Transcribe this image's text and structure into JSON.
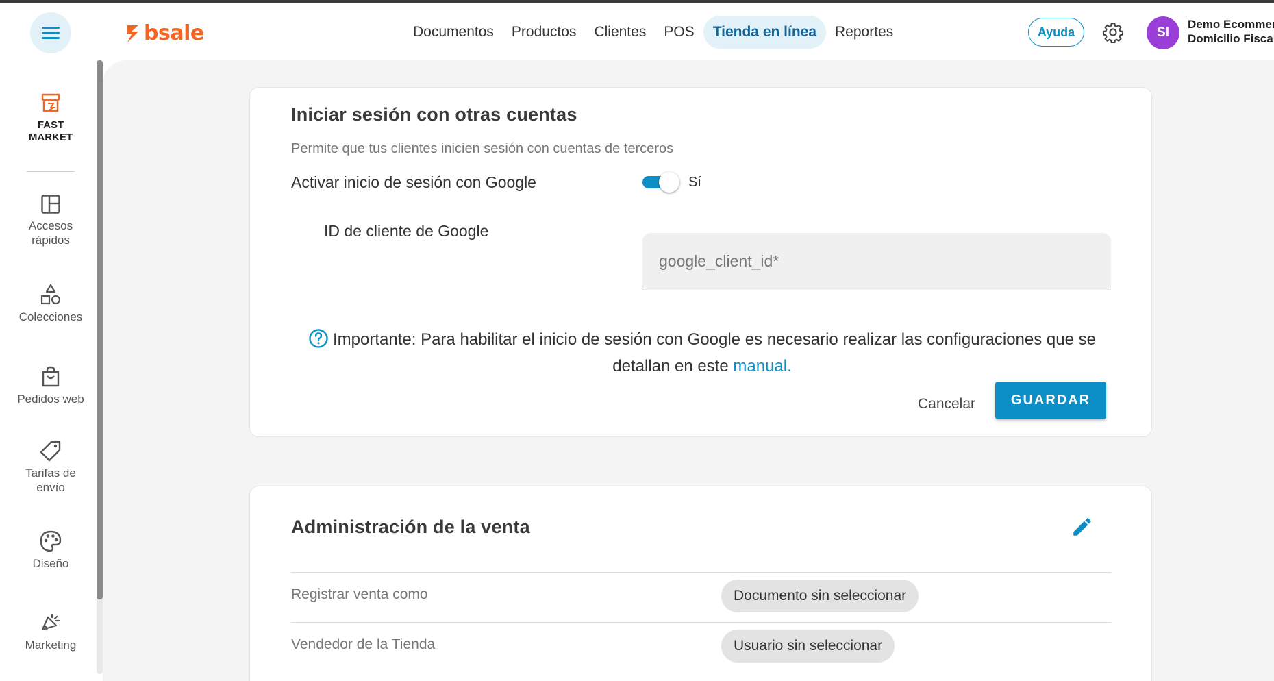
{
  "header": {
    "logo_text": "bsale",
    "nav": [
      "Documentos",
      "Productos",
      "Clientes",
      "POS",
      "Tienda en línea",
      "Reportes"
    ],
    "active_nav": "Tienda en línea",
    "help_label": "Ayuda",
    "avatar_initials": "SI",
    "company_line1": "Demo Ecommerce",
    "company_line2": "Domicilio Fiscal",
    "accent_color": "#0c8fc7",
    "logo_color": "#f26522",
    "avatar_color": "#9b3fd9"
  },
  "sidebar": {
    "fast_market": {
      "line1": "FAST",
      "line2": "MARKET",
      "icon": "storefront-icon"
    },
    "items": [
      {
        "label": "Accesos rápidos",
        "icon": "dashboard-layout-icon"
      },
      {
        "label": "Colecciones",
        "icon": "shapes-icon"
      },
      {
        "label": "Pedidos web",
        "icon": "shopping-bag-icon"
      },
      {
        "label": "Tarifas de envío",
        "icon": "price-tag-icon"
      },
      {
        "label": "Diseño",
        "icon": "palette-icon"
      },
      {
        "label": "Marketing",
        "icon": "megaphone-icon"
      }
    ]
  },
  "login_card": {
    "title": "Iniciar sesión con otras cuentas",
    "subtitle": "Permite que tus clientes inicien sesión con cuentas de terceros",
    "google_toggle_label": "Activar inicio de sesión con Google",
    "toggle_state": "Sí",
    "client_id_label": "ID de cliente de Google",
    "client_id_placeholder": "google_client_id*",
    "client_id_value": "",
    "note_text": "Importante: Para habilitar el inicio de sesión con Google es necesario realizar las configuraciones que se detallan en este",
    "note_link": "manual.",
    "cancel_label": "Cancelar",
    "save_label": "GUARDAR"
  },
  "sales_card": {
    "title": "Administración de la venta",
    "rows": [
      {
        "label": "Registrar venta como",
        "value": "Documento sin seleccionar"
      },
      {
        "label": "Vendedor de la Tienda",
        "value": "Usuario sin seleccionar"
      }
    ]
  }
}
